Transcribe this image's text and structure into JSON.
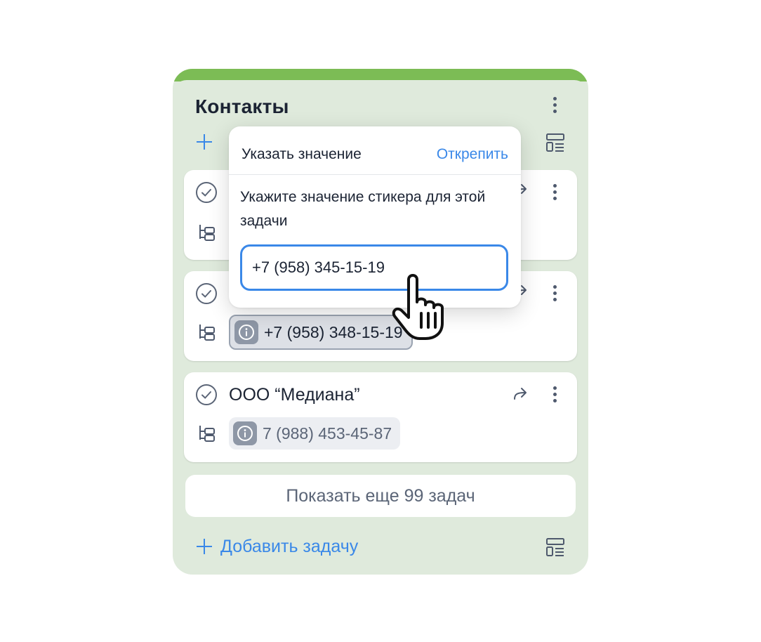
{
  "board": {
    "title": "Контакты",
    "accent_color": "#7cbc55",
    "background": "#dfeadc",
    "add_task_label": "Добавить задачу",
    "show_more_label": "Показать еще 99 задач"
  },
  "cards": [
    {
      "title": "",
      "chip": ""
    },
    {
      "title": "",
      "chip": "+7 (958) 348-15-19"
    },
    {
      "title": "ООО “Медиана”",
      "chip": "7 (988) 453-45-87"
    }
  ],
  "popover": {
    "title": "Указать значение",
    "action": "Открепить",
    "description": "Укажите значение стикера для этой задачи",
    "input_value": "+7 (958) 345-15-19"
  },
  "icons": {
    "complete": "check-circle-icon",
    "subtasks": "tree-icon",
    "share": "share-arrow-icon",
    "more": "kebab-icon",
    "info": "info-icon",
    "layout": "layout-icon",
    "add": "plus-icon",
    "pointer": "hand-pointer-icon"
  }
}
